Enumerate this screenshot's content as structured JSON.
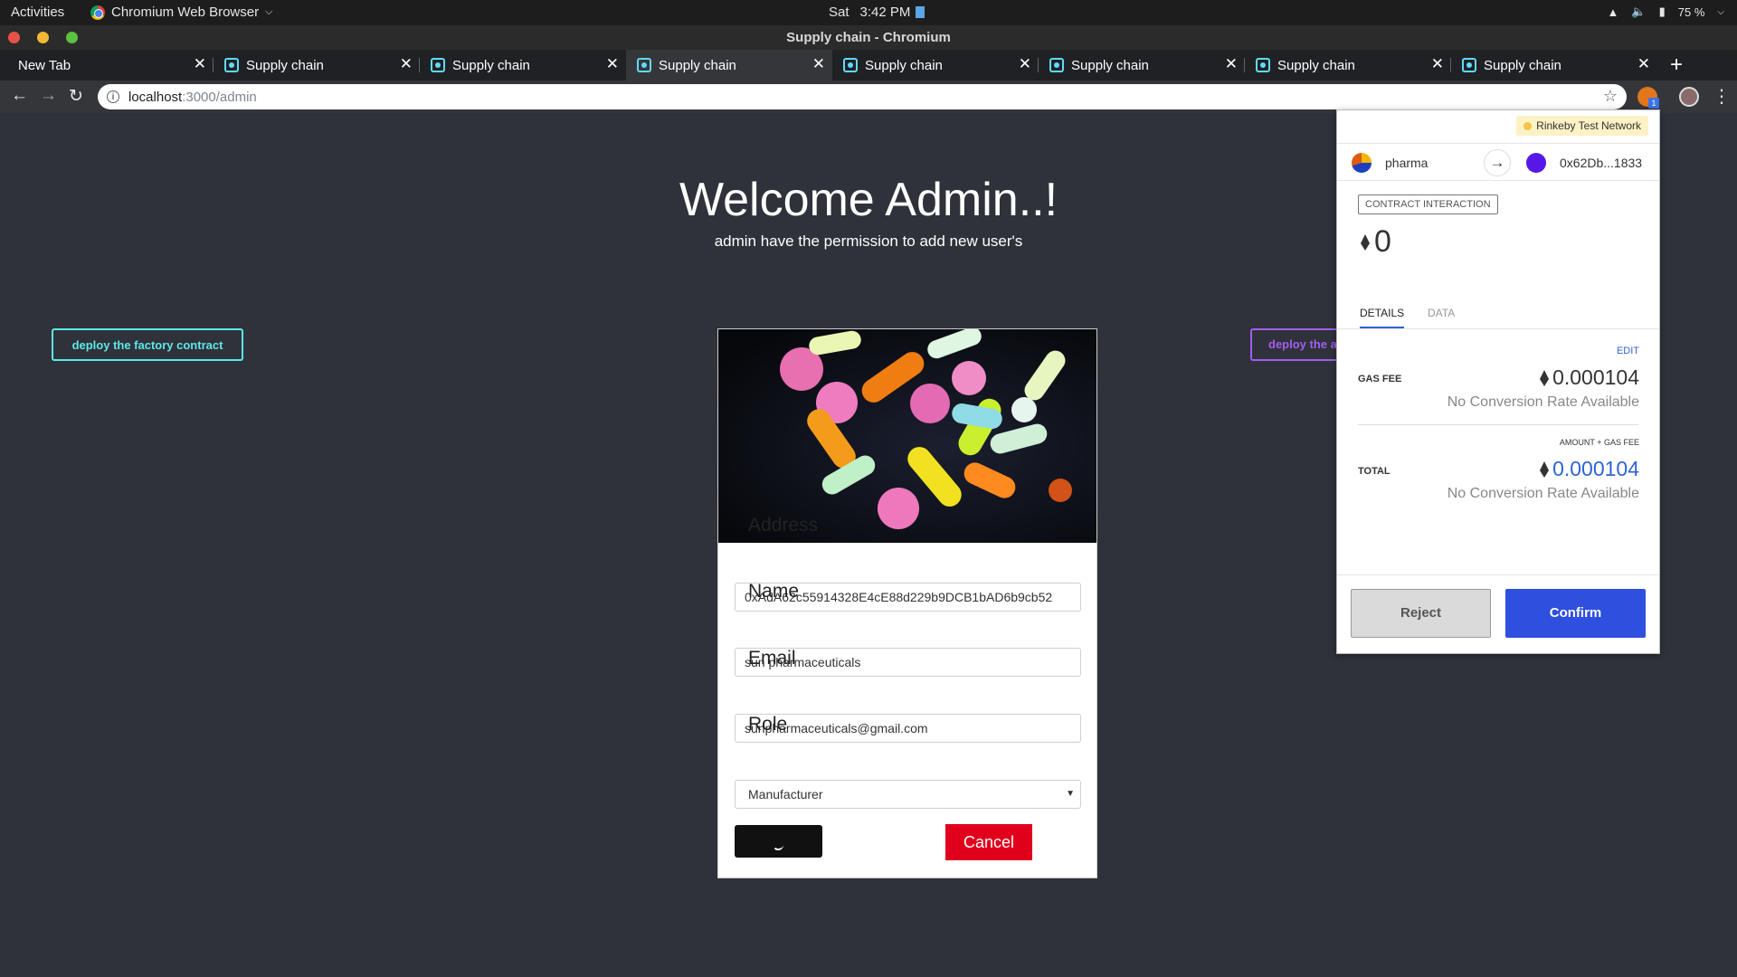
{
  "system_bar": {
    "activities": "Activities",
    "app_name": "Chromium Web Browser",
    "day": "Sat",
    "time": "3:42 PM",
    "battery": "75 %"
  },
  "window": {
    "title": "Supply chain - Chromium"
  },
  "tabs": [
    {
      "label": "New Tab"
    },
    {
      "label": "Supply chain"
    },
    {
      "label": "Supply chain"
    },
    {
      "label": "Supply chain"
    },
    {
      "label": "Supply chain"
    },
    {
      "label": "Supply chain"
    },
    {
      "label": "Supply chain"
    },
    {
      "label": "Supply chain"
    }
  ],
  "address_bar": {
    "host": "localhost",
    "path": ":3000/admin"
  },
  "extension_badge": "1",
  "page": {
    "title": "Welcome Admin..!",
    "subtitle": "admin have the permission to add new user's",
    "deploy_factory_label": "deploy the factory contract",
    "deploy_right_label": "deploy the a",
    "form": {
      "address_label": "Address",
      "address_value": "0xAdA62c55914328E4cE88d229b9DCB1bAD6b9cb52",
      "name_label": "Name",
      "name_value": "sun pharmaceuticals",
      "email_label": "Email",
      "email_value": "sunpharmaceuticals@gmail.com",
      "role_label": "Role",
      "role_value": "Manufacturer",
      "cancel_label": "Cancel"
    }
  },
  "metamask": {
    "network": "Rinkeby Test Network",
    "from_account": "pharma",
    "to_address": "0x62Db...1833",
    "tag": "CONTRACT INTERACTION",
    "amount": "0",
    "tab_details": "DETAILS",
    "tab_data": "DATA",
    "edit": "EDIT",
    "gas_fee_label": "GAS FEE",
    "gas_fee_value": "0.000104",
    "no_conversion": "No Conversion Rate Available",
    "amount_gas_label": "AMOUNT + GAS FEE",
    "total_label": "TOTAL",
    "total_value": "0.000104",
    "reject_label": "Reject",
    "confirm_label": "Confirm"
  }
}
